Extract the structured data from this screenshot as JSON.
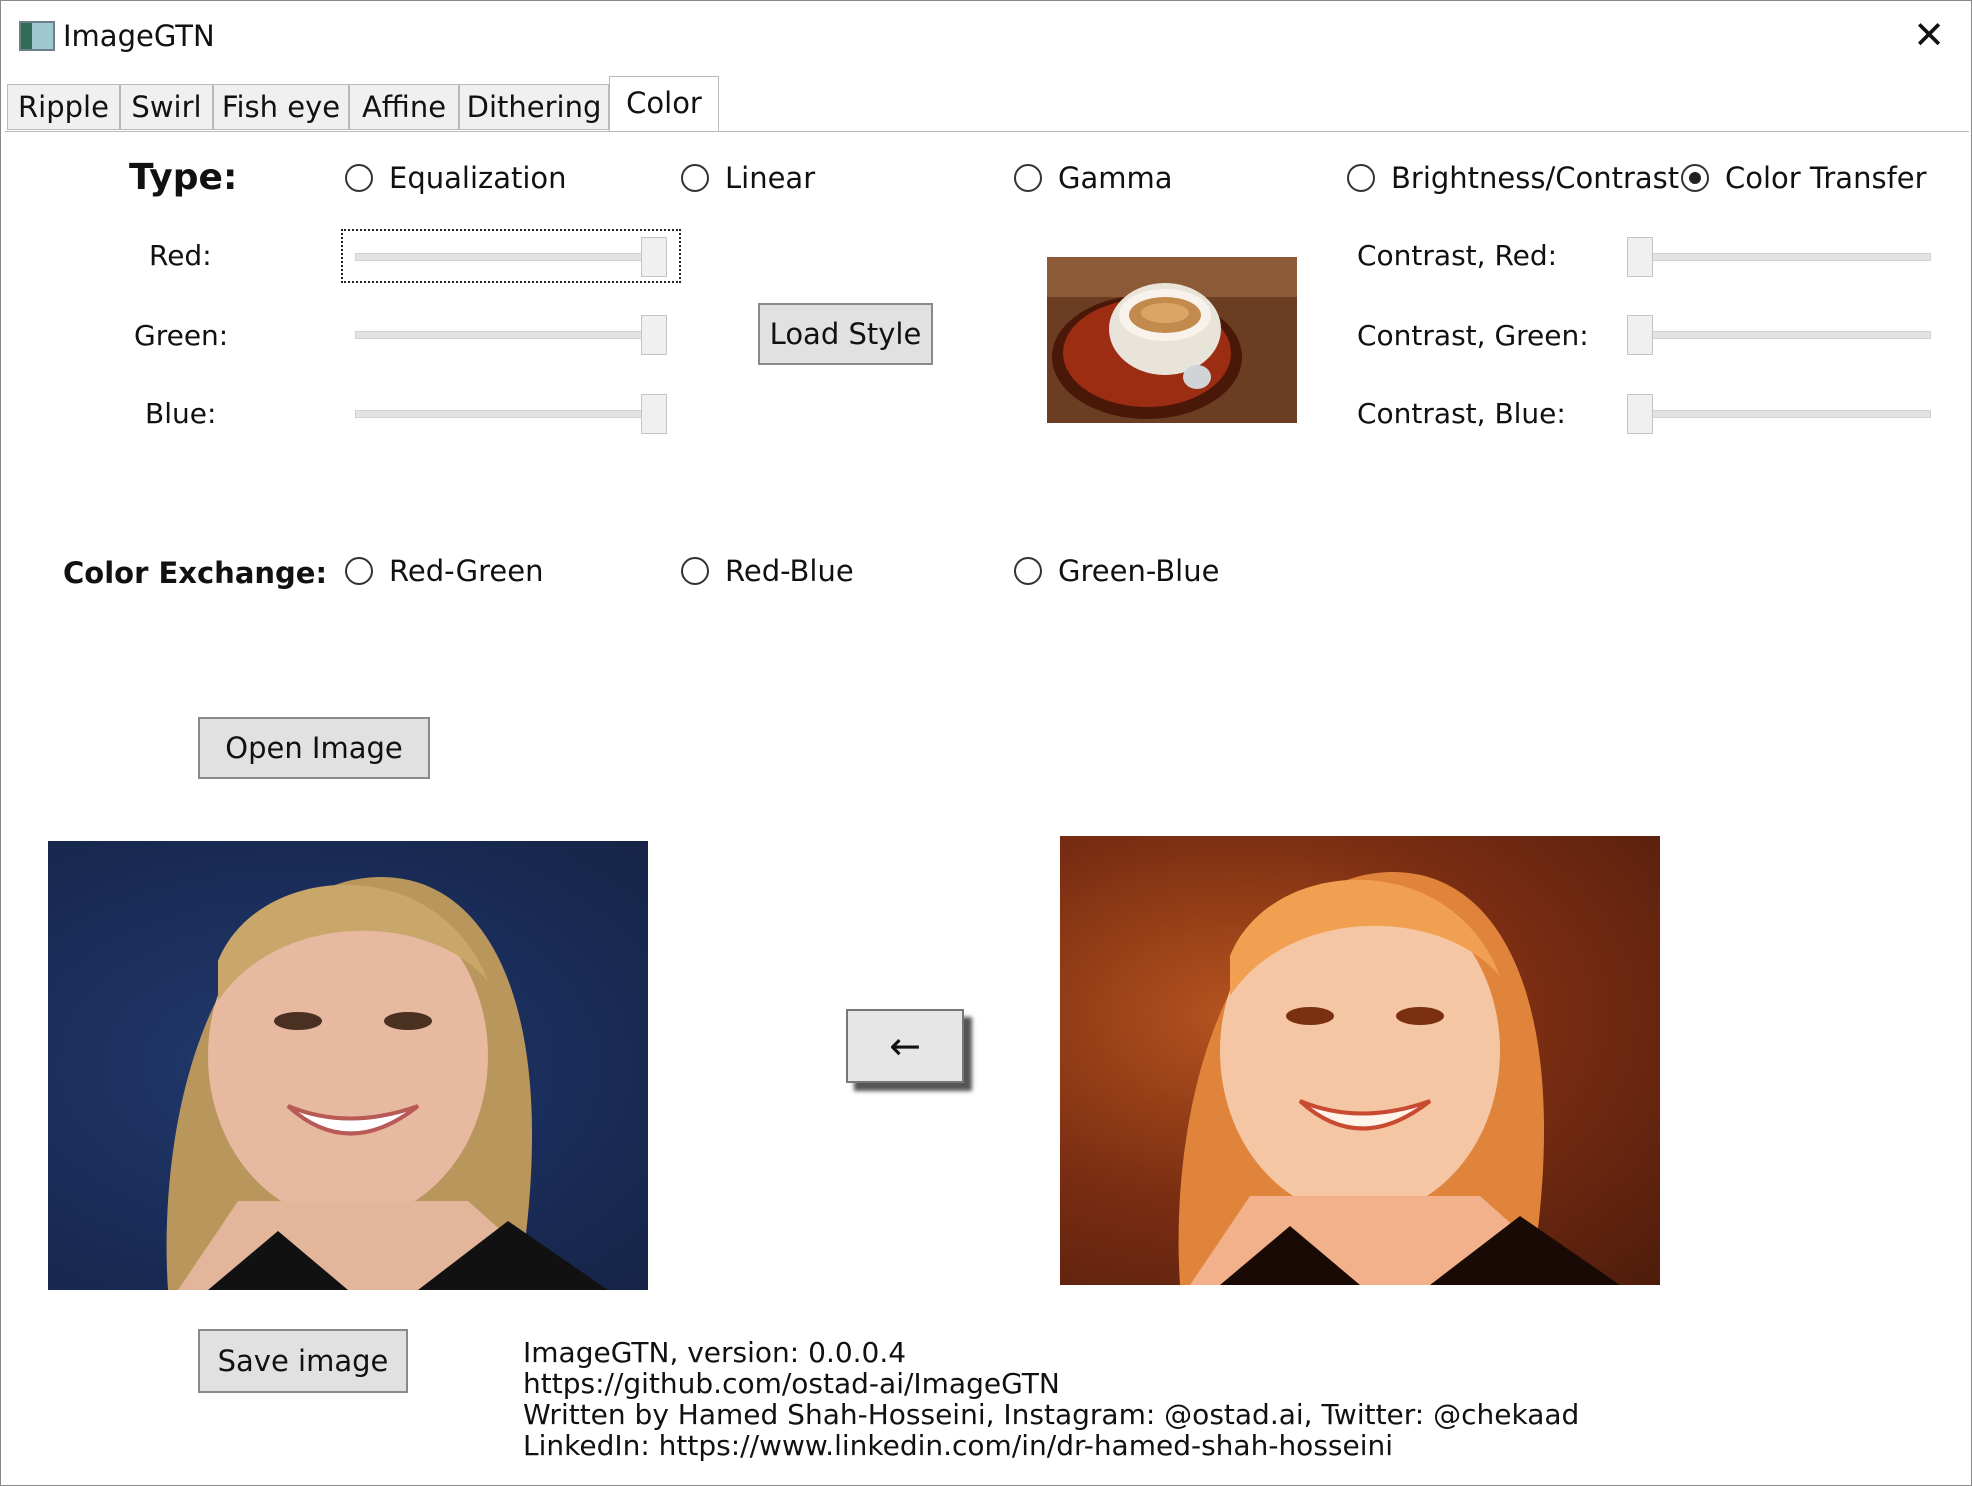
{
  "window": {
    "title": "ImageGTN",
    "close_glyph": "✕"
  },
  "tabs": [
    {
      "label": "Ripple",
      "active": false
    },
    {
      "label": "Swirl",
      "active": false
    },
    {
      "label": "Fish eye",
      "active": false
    },
    {
      "label": "Affine",
      "active": false
    },
    {
      "label": "Dithering",
      "active": false
    },
    {
      "label": "Color",
      "active": true
    }
  ],
  "type_section": {
    "label": "Type:",
    "options": [
      {
        "label": "Equalization",
        "checked": false
      },
      {
        "label": "Linear",
        "checked": false
      },
      {
        "label": "Gamma",
        "checked": false
      },
      {
        "label": "Brightness/Contrast",
        "checked": false
      },
      {
        "label": "Color Transfer",
        "checked": true
      }
    ]
  },
  "channel_sliders": [
    {
      "label": "Red:",
      "value": 1.0
    },
    {
      "label": "Green:",
      "value": 1.0
    },
    {
      "label": "Blue:",
      "value": 1.0
    }
  ],
  "load_style_label": "Load Style",
  "contrast_sliders": [
    {
      "label": "Contrast, Red:",
      "value": 0.0
    },
    {
      "label": "Contrast, Green:",
      "value": 0.0
    },
    {
      "label": "Contrast, Blue:",
      "value": 0.0
    }
  ],
  "color_exchange": {
    "label": "Color Exchange:",
    "options": [
      {
        "label": "Red-Green",
        "checked": false
      },
      {
        "label": "Red-Blue",
        "checked": false
      },
      {
        "label": "Green-Blue",
        "checked": false
      }
    ]
  },
  "open_image_label": "Open Image",
  "save_image_label": "Save image",
  "arrow_label": "←",
  "info_lines": [
    "ImageGTN, version: 0.0.0.4",
    "https://github.com/ostad-ai/ImageGTN",
    "Written by Hamed Shah-Hosseini, Instagram: @ostad.ai, Twitter: @chekaad",
    "LinkedIn: https://www.linkedin.com/in/dr-hamed-shah-hosseini"
  ]
}
